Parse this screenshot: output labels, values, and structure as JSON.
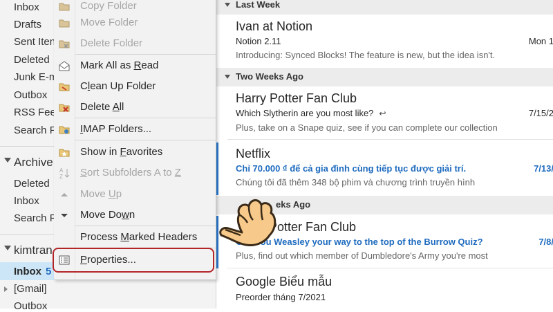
{
  "folders_top": [
    {
      "label": "Inbox"
    },
    {
      "label": "Drafts"
    },
    {
      "label": "Sent Iten"
    },
    {
      "label": "Deleted"
    },
    {
      "label": "Junk E-m"
    },
    {
      "label": "Outbox"
    },
    {
      "label": "RSS Feed"
    },
    {
      "label": "Search F"
    }
  ],
  "archive": {
    "label": "Archive",
    "items": [
      {
        "label": "Deleted"
      },
      {
        "label": "Inbox"
      },
      {
        "label": "Search F"
      }
    ]
  },
  "account": {
    "label": "kimtran",
    "inbox_label": "Inbox",
    "inbox_count": "5",
    "gmail_label": "[Gmail]",
    "outbox_label": "Outbox"
  },
  "context_menu": {
    "items": [
      {
        "label": "Copy Folder",
        "icon": "copy-folder-icon",
        "disabled": true
      },
      {
        "label": "Move Folder",
        "icon": "move-folder-icon",
        "disabled": true
      },
      {
        "label": "Delete Folder",
        "icon": "delete-folder-icon",
        "disabled": true
      },
      {
        "label": "Mark All as Read",
        "icon": "envelope-open-icon",
        "disabled": false
      },
      {
        "label": "Clean Up Folder",
        "icon": "clean-up-icon",
        "disabled": false
      },
      {
        "label": "Delete All",
        "icon": "delete-all-icon",
        "disabled": false
      },
      {
        "label": "IMAP Folders...",
        "icon": "imap-folders-icon",
        "disabled": false
      },
      {
        "label": "Show in Favorites",
        "icon": "star-folder-icon",
        "disabled": false
      },
      {
        "label": "Sort Subfolders A to Z",
        "icon": "sort-az-icon",
        "disabled": true
      },
      {
        "label": "Move Up",
        "icon": "arrow-up-icon",
        "disabled": true
      },
      {
        "label": "Move Down",
        "icon": "arrow-down-icon",
        "disabled": false
      },
      {
        "label": "Process Marked Headers",
        "icon": "",
        "disabled": false
      },
      {
        "label": "Properties...",
        "icon": "properties-icon",
        "disabled": false
      }
    ]
  },
  "groups": [
    {
      "label": "Last Week"
    },
    {
      "label": "Two Weeks Ago"
    },
    {
      "label": "eks Ago"
    }
  ],
  "messages": [
    {
      "sender": "Ivan at Notion",
      "subject": "Notion 2.11",
      "preview": "Introducing: Synced Blocks! The feature is new, but the idea isn't.",
      "date": "Mon 1",
      "unread": false
    },
    {
      "sender": "Harry Potter Fan Club",
      "subject": "Which Slytherin are you most like?",
      "preview": "Plus, take on a Snape quiz, see if you can complete our collection",
      "date": "7/15/2",
      "unread": false
    },
    {
      "sender": "Netflix",
      "subject": "Chỉ 70.000 ₫ để cả gia đình cùng tiếp tục được giải trí.",
      "preview": "Chúng tôi đã thêm 348 bộ phim và chương trình truyền hình",
      "date": "7/13/",
      "unread": true
    },
    {
      "sender": "Potter Fan Club",
      "subject": "Can You Weasley your way to the top of the Burrow Quiz?",
      "preview": "Plus, find out which member of Dumbledore's Army you're most",
      "date": "7/8/",
      "unread": true
    },
    {
      "sender": "Google Biểu mẫu",
      "subject": "Preorder tháng 7/2021",
      "preview": "",
      "date": "",
      "unread": false
    }
  ],
  "colors": {
    "accent": "#1e6bbf",
    "highlight_border": "#b2262a",
    "selected_folder": "#cde6f7"
  }
}
